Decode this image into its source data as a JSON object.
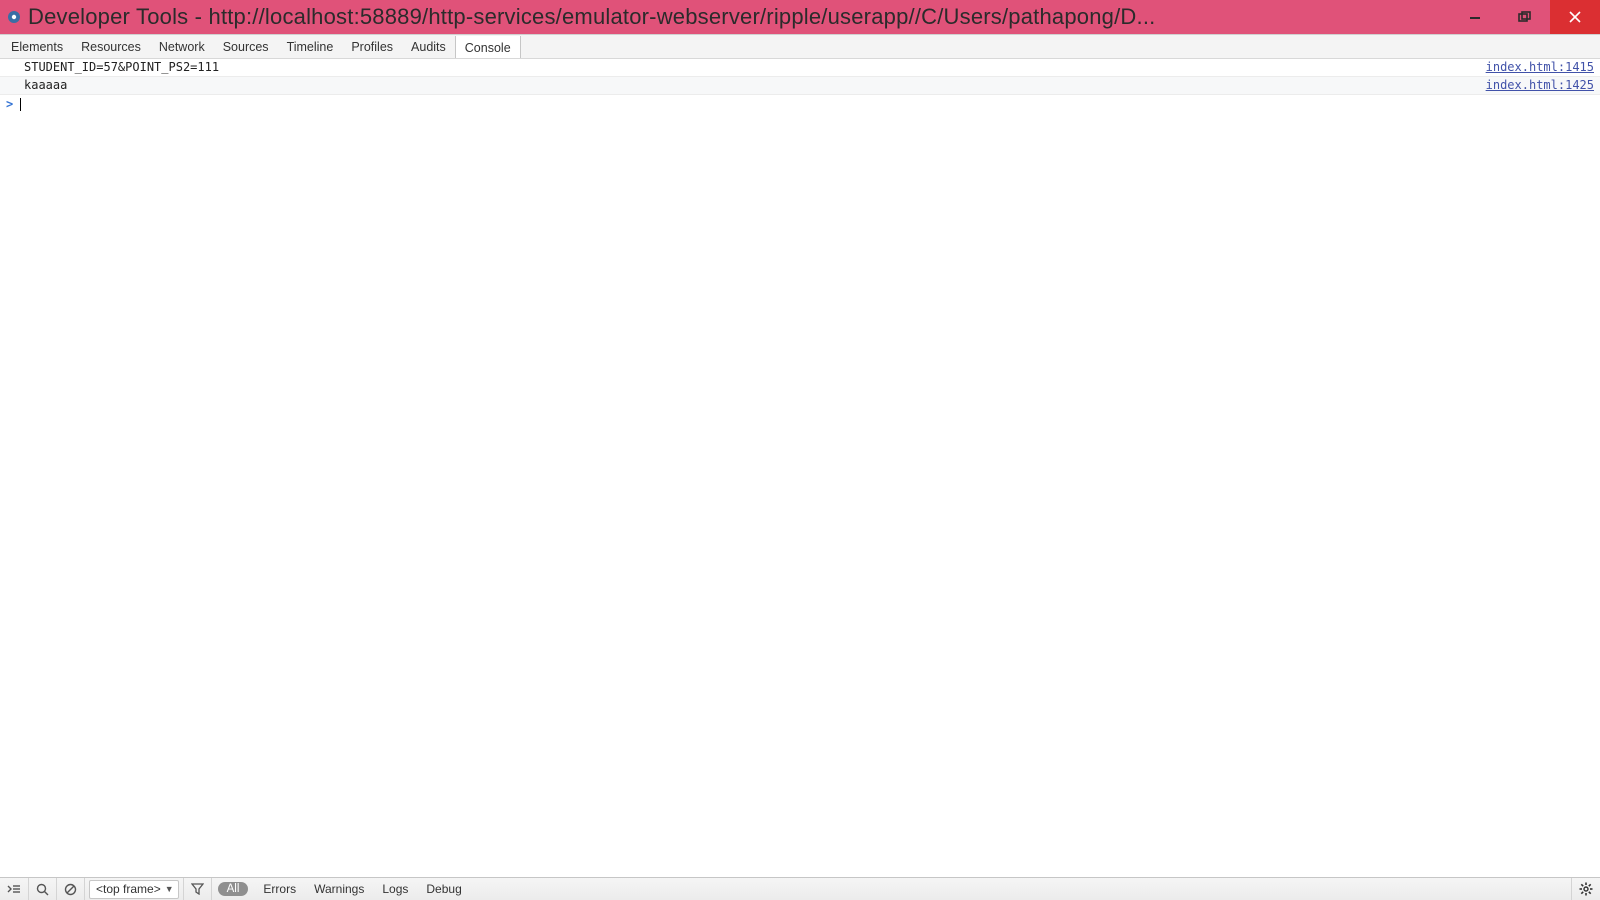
{
  "window": {
    "title": "Developer Tools - http://localhost:58889/http-services/emulator-webserver/ripple/userapp//C/Users/pathapong/D..."
  },
  "tabs": {
    "items": [
      "Elements",
      "Resources",
      "Network",
      "Sources",
      "Timeline",
      "Profiles",
      "Audits",
      "Console"
    ],
    "active_index": 7
  },
  "console": {
    "logs": [
      {
        "msg": "STUDENT_ID=57&POINT_PS2=111",
        "src": "index.html:1415"
      },
      {
        "msg": "kaaaaa",
        "src": "index.html:1425"
      }
    ],
    "prompt_chevron": ">"
  },
  "statusbar": {
    "frame_selector": "<top frame>",
    "filters": {
      "all": "All",
      "errors": "Errors",
      "warnings": "Warnings",
      "logs": "Logs",
      "debug": "Debug"
    }
  }
}
